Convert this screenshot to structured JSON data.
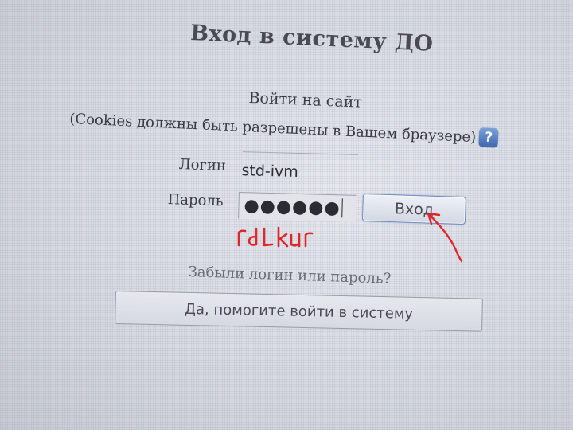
{
  "page": {
    "title": "Вход в систему ДО"
  },
  "login_form": {
    "heading": "Войти на сайт",
    "cookies_notice": "(Cookies должны быть разрешены в Вашем браузере)",
    "help_icon": "question-mark-icon",
    "login_label": "Логин",
    "login_value": "std-ivm",
    "password_label": "Пароль",
    "password_masked": "●●●●●●",
    "submit_label": "Вход"
  },
  "annotation": {
    "handwritten_password": "rdLkur",
    "color": "#e0262a"
  },
  "recovery": {
    "question": "Забыли логин или пароль?",
    "button_label": "Да, помогите войти в систему"
  },
  "colors": {
    "background": "#d9dce3",
    "help_icon": "#4a72bf",
    "button_border": "#6f8cc0",
    "annotation": "#e0262a"
  }
}
